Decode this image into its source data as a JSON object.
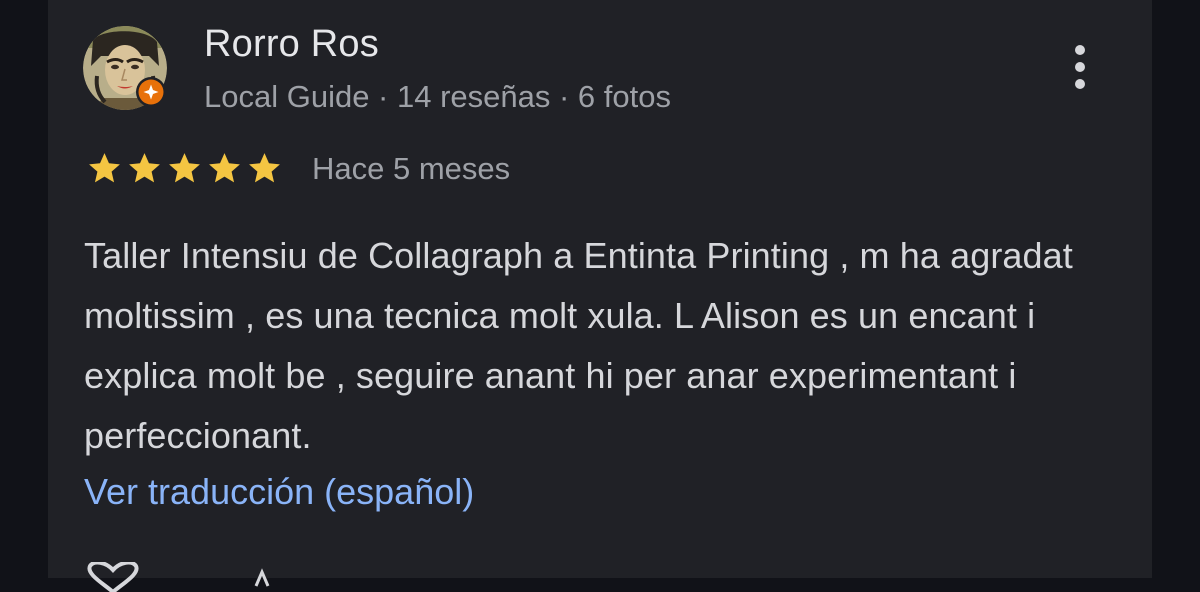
{
  "colors": {
    "background": "#111218",
    "card": "#202126",
    "primary_text": "#e6e7ea",
    "secondary_text": "#9ea1a7",
    "body_text": "#d6d7db",
    "link": "#8ab4f8",
    "star": "#f4c542",
    "local_guide_badge": "#e8710a"
  },
  "review": {
    "reviewer": {
      "name": "Rorro Ros",
      "meta": "Local Guide · 14 reseñas · 6 fotos",
      "avatar_icon": "avatar-portrait",
      "badge_icon": "local-guide-badge-icon"
    },
    "rating": 5,
    "rating_max": 5,
    "date": "Hace 5 meses",
    "text": "Taller Intensiu de Collagraph a Entinta Printing , m ha agradat moltissim , es una tecnica molt xula. L Alison es un encant i explica molt be , seguire anant hi per anar experimentant i perfeccionant.",
    "translate_link": "Ver traducción (español)",
    "more_menu_icon": "more-vert-icon",
    "like_icon": "heart-like-icon"
  }
}
